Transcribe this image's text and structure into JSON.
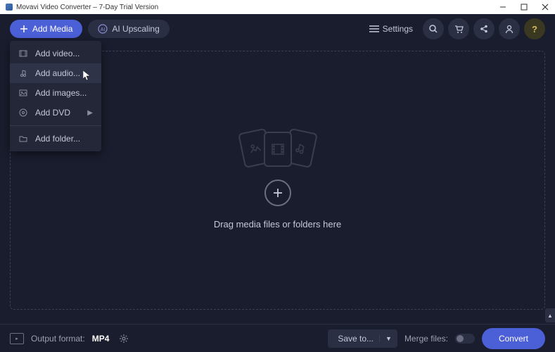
{
  "titlebar": {
    "title": "Movavi Video Converter – 7-Day Trial Version"
  },
  "toolbar": {
    "add_media_label": "Add Media",
    "ai_upscaling_label": "AI Upscaling",
    "settings_label": "Settings"
  },
  "menu": {
    "items": [
      {
        "label": "Add video..."
      },
      {
        "label": "Add audio..."
      },
      {
        "label": "Add images..."
      },
      {
        "label": "Add DVD"
      },
      {
        "label": "Add folder..."
      }
    ]
  },
  "dropzone": {
    "text": "Drag media files or folders here"
  },
  "bottombar": {
    "output_label": "Output format:",
    "output_format": "MP4",
    "save_label": "Save to...",
    "merge_label": "Merge files:",
    "convert_label": "Convert"
  }
}
